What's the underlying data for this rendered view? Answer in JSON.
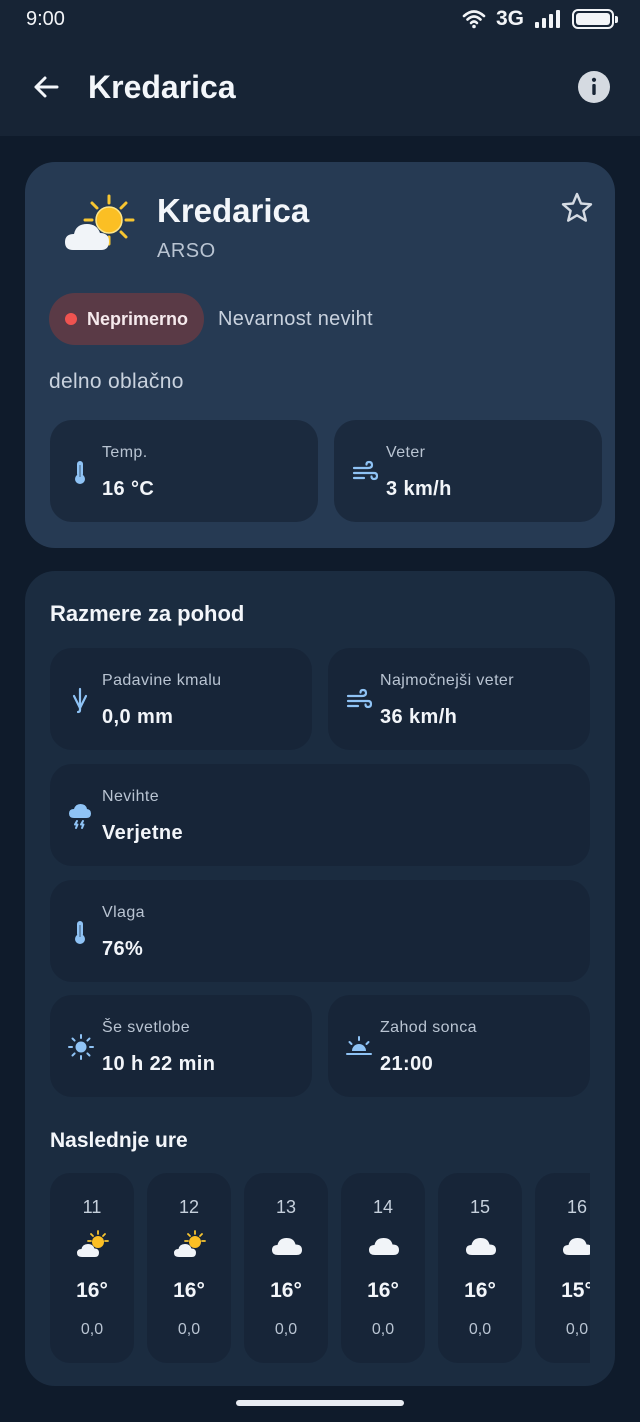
{
  "status_bar": {
    "time": "9:00",
    "network": "3G"
  },
  "app_bar": {
    "title": "Kredarica"
  },
  "location": {
    "name": "Kredarica",
    "source": "ARSO",
    "badge": "Neprimerno",
    "hazard": "Nevarnost neviht",
    "condition": "delno oblačno",
    "temp_label": "Temp.",
    "temp_value": "16 °C",
    "wind_label": "Veter",
    "wind_value": "3 km/h"
  },
  "hike": {
    "title": "Razmere za pohod",
    "precip_label": "Padavine kmalu",
    "precip_value": "0,0 mm",
    "gust_label": "Najmočnejši veter",
    "gust_value": "36 km/h",
    "storm_label": "Nevihte",
    "storm_value": "Verjetne",
    "humidity_label": "Vlaga",
    "humidity_value": "76%",
    "daylight_label": "Še svetlobe",
    "daylight_value": "10 h 22 min",
    "sunset_label": "Zahod sonca",
    "sunset_value": "21:00",
    "hourly_title": "Naslednje ure",
    "hours": [
      {
        "hour": "11",
        "icon": "partly-cloudy-icon",
        "temp": "16°",
        "precip": "0,0"
      },
      {
        "hour": "12",
        "icon": "partly-cloudy-icon",
        "temp": "16°",
        "precip": "0,0"
      },
      {
        "hour": "13",
        "icon": "cloud-icon",
        "temp": "16°",
        "precip": "0,0"
      },
      {
        "hour": "14",
        "icon": "cloud-icon",
        "temp": "16°",
        "precip": "0,0"
      },
      {
        "hour": "15",
        "icon": "cloud-icon",
        "temp": "16°",
        "precip": "0,0"
      },
      {
        "hour": "16",
        "icon": "cloud-icon",
        "temp": "15°",
        "precip": "0,0"
      }
    ]
  },
  "colors": {
    "background": "#0f1b2b",
    "card_main": "#263a53",
    "card_hike": "#1b2c40",
    "badge_bg": "#5a3a46",
    "badge_dot": "#ef5350",
    "icon_blue": "#8fc3f5"
  }
}
